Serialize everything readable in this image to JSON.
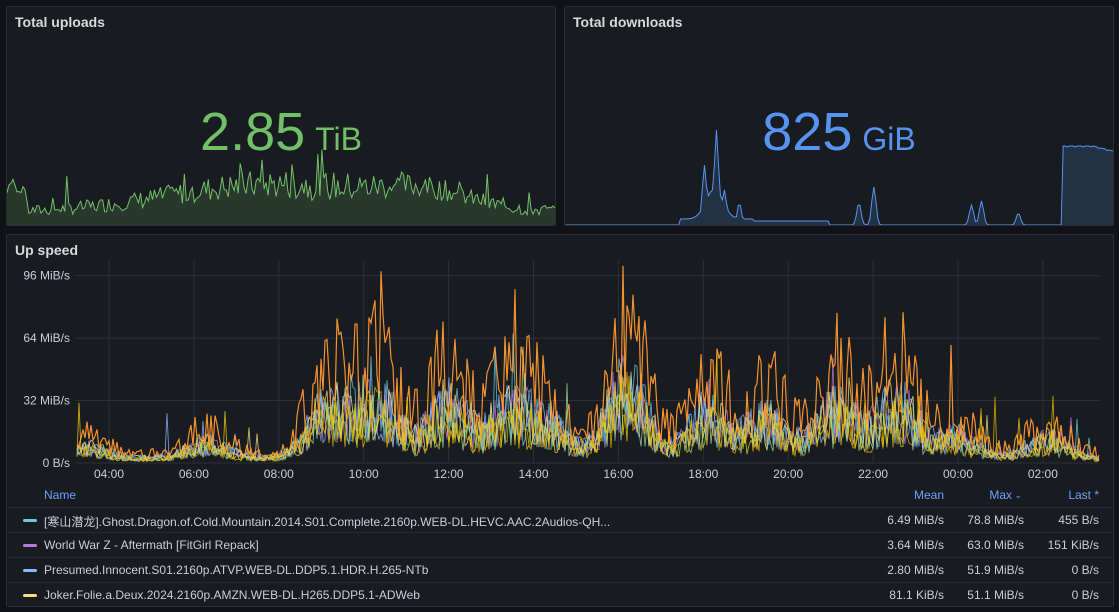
{
  "uploads": {
    "title": "Total uploads",
    "value": "2.85",
    "unit": "TiB",
    "color": "#73bf69"
  },
  "downloads": {
    "title": "Total downloads",
    "value": "825",
    "unit": "GiB",
    "color": "#5794f2"
  },
  "speed": {
    "title": "Up speed",
    "legend": {
      "headers": {
        "name": "Name",
        "mean": "Mean",
        "max": "Max",
        "max_sort_icon": "chevron-down-icon",
        "last": "Last *"
      },
      "rows": [
        {
          "name": "[寒山潜龙].Ghost.Dragon.of.Cold.Mountain.2014.S01.Complete.2160p.WEB-DL.HEVC.AAC.2Audios-QH...",
          "mean": "6.49 MiB/s",
          "max": "78.8 MiB/s",
          "last": "455 B/s",
          "color": "#6ccadc"
        },
        {
          "name": "World War Z - Aftermath [FitGirl Repack]",
          "mean": "3.64 MiB/s",
          "max": "63.0 MiB/s",
          "last": "151 KiB/s",
          "color": "#b877d9"
        },
        {
          "name": "Presumed.Innocent.S01.2160p.ATVP.WEB-DL.DDP5.1.HDR.H.265-NTb",
          "mean": "2.80 MiB/s",
          "max": "51.9 MiB/s",
          "last": "0 B/s",
          "color": "#8ab8ff"
        },
        {
          "name": "Joker.Folie.a.Deux.2024.2160p.AMZN.WEB-DL.H265.DDP5.1-ADWeb",
          "mean": "81.1 KiB/s",
          "max": "51.1 MiB/s",
          "last": "0 B/s",
          "color": "#fade7a"
        }
      ]
    }
  },
  "chart_data": {
    "type": "line",
    "title": "Up speed",
    "y_ticks": [
      "0 B/s",
      "32 MiB/s",
      "64 MiB/s",
      "96 MiB/s"
    ],
    "x_ticks": [
      "04:00",
      "06:00",
      "08:00",
      "10:00",
      "12:00",
      "14:00",
      "16:00",
      "18:00",
      "20:00",
      "22:00",
      "00:00",
      "02:00"
    ],
    "ylim_mib": [
      0,
      104
    ],
    "grid": true,
    "legend_position": "bottom",
    "series_colors": [
      "#6ccadc",
      "#b877d9",
      "#8ab8ff",
      "#fade7a",
      "#ff9830",
      "#e0b400",
      "#9fd8a0",
      "#f2cc0c"
    ]
  }
}
